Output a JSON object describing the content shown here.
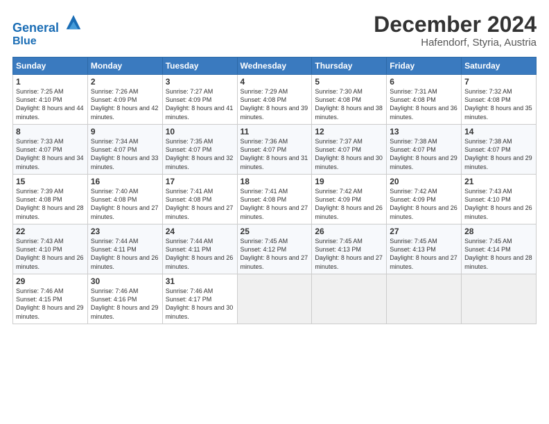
{
  "header": {
    "logo_line1": "General",
    "logo_line2": "Blue",
    "month_title": "December 2024",
    "location": "Hafendorf, Styria, Austria"
  },
  "days_of_week": [
    "Sunday",
    "Monday",
    "Tuesday",
    "Wednesday",
    "Thursday",
    "Friday",
    "Saturday"
  ],
  "weeks": [
    [
      {
        "num": "1",
        "sunrise": "7:25 AM",
        "sunset": "4:10 PM",
        "daylight": "8 hours and 44 minutes."
      },
      {
        "num": "2",
        "sunrise": "7:26 AM",
        "sunset": "4:09 PM",
        "daylight": "8 hours and 42 minutes."
      },
      {
        "num": "3",
        "sunrise": "7:27 AM",
        "sunset": "4:09 PM",
        "daylight": "8 hours and 41 minutes."
      },
      {
        "num": "4",
        "sunrise": "7:29 AM",
        "sunset": "4:08 PM",
        "daylight": "8 hours and 39 minutes."
      },
      {
        "num": "5",
        "sunrise": "7:30 AM",
        "sunset": "4:08 PM",
        "daylight": "8 hours and 38 minutes."
      },
      {
        "num": "6",
        "sunrise": "7:31 AM",
        "sunset": "4:08 PM",
        "daylight": "8 hours and 36 minutes."
      },
      {
        "num": "7",
        "sunrise": "7:32 AM",
        "sunset": "4:08 PM",
        "daylight": "8 hours and 35 minutes."
      }
    ],
    [
      {
        "num": "8",
        "sunrise": "7:33 AM",
        "sunset": "4:07 PM",
        "daylight": "8 hours and 34 minutes."
      },
      {
        "num": "9",
        "sunrise": "7:34 AM",
        "sunset": "4:07 PM",
        "daylight": "8 hours and 33 minutes."
      },
      {
        "num": "10",
        "sunrise": "7:35 AM",
        "sunset": "4:07 PM",
        "daylight": "8 hours and 32 minutes."
      },
      {
        "num": "11",
        "sunrise": "7:36 AM",
        "sunset": "4:07 PM",
        "daylight": "8 hours and 31 minutes."
      },
      {
        "num": "12",
        "sunrise": "7:37 AM",
        "sunset": "4:07 PM",
        "daylight": "8 hours and 30 minutes."
      },
      {
        "num": "13",
        "sunrise": "7:38 AM",
        "sunset": "4:07 PM",
        "daylight": "8 hours and 29 minutes."
      },
      {
        "num": "14",
        "sunrise": "7:38 AM",
        "sunset": "4:07 PM",
        "daylight": "8 hours and 29 minutes."
      }
    ],
    [
      {
        "num": "15",
        "sunrise": "7:39 AM",
        "sunset": "4:08 PM",
        "daylight": "8 hours and 28 minutes."
      },
      {
        "num": "16",
        "sunrise": "7:40 AM",
        "sunset": "4:08 PM",
        "daylight": "8 hours and 27 minutes."
      },
      {
        "num": "17",
        "sunrise": "7:41 AM",
        "sunset": "4:08 PM",
        "daylight": "8 hours and 27 minutes."
      },
      {
        "num": "18",
        "sunrise": "7:41 AM",
        "sunset": "4:08 PM",
        "daylight": "8 hours and 27 minutes."
      },
      {
        "num": "19",
        "sunrise": "7:42 AM",
        "sunset": "4:09 PM",
        "daylight": "8 hours and 26 minutes."
      },
      {
        "num": "20",
        "sunrise": "7:42 AM",
        "sunset": "4:09 PM",
        "daylight": "8 hours and 26 minutes."
      },
      {
        "num": "21",
        "sunrise": "7:43 AM",
        "sunset": "4:10 PM",
        "daylight": "8 hours and 26 minutes."
      }
    ],
    [
      {
        "num": "22",
        "sunrise": "7:43 AM",
        "sunset": "4:10 PM",
        "daylight": "8 hours and 26 minutes."
      },
      {
        "num": "23",
        "sunrise": "7:44 AM",
        "sunset": "4:11 PM",
        "daylight": "8 hours and 26 minutes."
      },
      {
        "num": "24",
        "sunrise": "7:44 AM",
        "sunset": "4:11 PM",
        "daylight": "8 hours and 26 minutes."
      },
      {
        "num": "25",
        "sunrise": "7:45 AM",
        "sunset": "4:12 PM",
        "daylight": "8 hours and 27 minutes."
      },
      {
        "num": "26",
        "sunrise": "7:45 AM",
        "sunset": "4:13 PM",
        "daylight": "8 hours and 27 minutes."
      },
      {
        "num": "27",
        "sunrise": "7:45 AM",
        "sunset": "4:13 PM",
        "daylight": "8 hours and 27 minutes."
      },
      {
        "num": "28",
        "sunrise": "7:45 AM",
        "sunset": "4:14 PM",
        "daylight": "8 hours and 28 minutes."
      }
    ],
    [
      {
        "num": "29",
        "sunrise": "7:46 AM",
        "sunset": "4:15 PM",
        "daylight": "8 hours and 29 minutes."
      },
      {
        "num": "30",
        "sunrise": "7:46 AM",
        "sunset": "4:16 PM",
        "daylight": "8 hours and 29 minutes."
      },
      {
        "num": "31",
        "sunrise": "7:46 AM",
        "sunset": "4:17 PM",
        "daylight": "8 hours and 30 minutes."
      },
      null,
      null,
      null,
      null
    ]
  ]
}
